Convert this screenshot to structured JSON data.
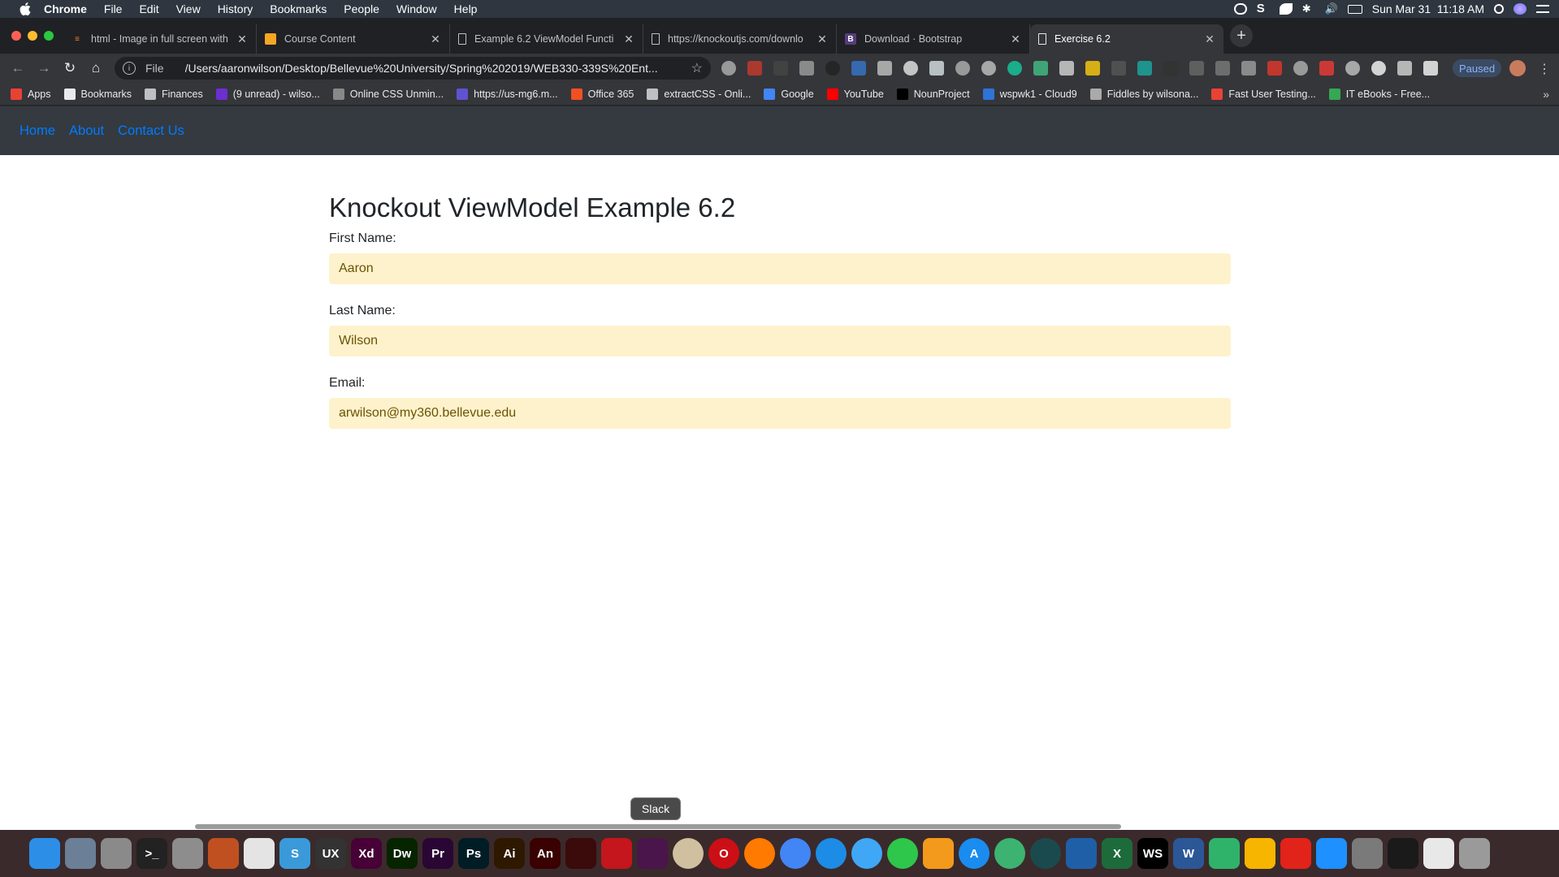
{
  "menubar": {
    "app": "Chrome",
    "items": [
      "File",
      "Edit",
      "View",
      "History",
      "Bookmarks",
      "People",
      "Window",
      "Help"
    ],
    "clock": "Sun Mar 31  11:18 AM"
  },
  "tabs": [
    {
      "title": "html - Image in full screen with",
      "icon": "stackoverflow-icon"
    },
    {
      "title": "Course Content",
      "icon": "course-icon"
    },
    {
      "title": "Example 6.2 ViewModel Functi",
      "icon": "page-icon"
    },
    {
      "title": "https://knockoutjs.com/downlo",
      "icon": "page-icon"
    },
    {
      "title": "Download · Bootstrap",
      "icon": "bootstrap-icon"
    },
    {
      "title": "Exercise 6.2",
      "icon": "page-icon",
      "active": true
    }
  ],
  "omnibox": {
    "scheme": "File",
    "url": "/Users/aaronwilson/Desktop/Bellevue%20University/Spring%202019/WEB330-339S%20Ent..."
  },
  "profile": {
    "status": "Paused"
  },
  "bookmarks": [
    {
      "label": "Apps",
      "color": "#e94235"
    },
    {
      "label": "Bookmarks",
      "color": "#e8eaed"
    },
    {
      "label": "Finances",
      "color": "#bdc1c6"
    },
    {
      "label": "(9 unread) - wilso...",
      "color": "#6b2fd2"
    },
    {
      "label": "Online CSS Unmin...",
      "color": "#888888"
    },
    {
      "label": "https://us-mg6.m...",
      "color": "#5f53d1"
    },
    {
      "label": "Office 365",
      "color": "#f25022"
    },
    {
      "label": "extractCSS - Onli...",
      "color": "#bdc1c6"
    },
    {
      "label": "Google",
      "color": "#4285f4"
    },
    {
      "label": "YouTube",
      "color": "#ff0000"
    },
    {
      "label": "NounProject",
      "color": "#000000"
    },
    {
      "label": "wspwk1 - Cloud9",
      "color": "#2f73d8"
    },
    {
      "label": "Fiddles by wilsona...",
      "color": "#aaaaaa"
    },
    {
      "label": "Fast User Testing...",
      "color": "#e94235"
    },
    {
      "label": "IT eBooks - Free...",
      "color": "#34a853"
    }
  ],
  "page": {
    "nav": [
      "Home",
      "About",
      "Contact Us"
    ],
    "heading": "Knockout ViewModel Example 6.2",
    "fields": [
      {
        "label": "First Name:",
        "value": "Aaron"
      },
      {
        "label": "Last Name:",
        "value": "Wilson"
      },
      {
        "label": "Email:",
        "value": "arwilson@my360.bellevue.edu"
      }
    ]
  },
  "dock": {
    "tooltip": "Slack",
    "apps": [
      {
        "name": "finder",
        "text": "",
        "color": "#2d8ee8"
      },
      {
        "name": "launchpad",
        "text": "",
        "color": "#6b7f96"
      },
      {
        "name": "system-preferences",
        "text": "",
        "color": "#8a8a8a"
      },
      {
        "name": "terminal",
        "text": ">_",
        "color": "#222222"
      },
      {
        "name": "calculator",
        "text": "",
        "color": "#8d8d8d"
      },
      {
        "name": "photo-booth",
        "text": "",
        "color": "#c0501f"
      },
      {
        "name": "reader",
        "text": "",
        "color": "#e4e4e4"
      },
      {
        "name": "sublime",
        "text": "S",
        "color": "#3a9ad9"
      },
      {
        "name": "uxpin",
        "text": "UX",
        "color": "#333333"
      },
      {
        "name": "xd",
        "text": "Xd",
        "color": "#470137"
      },
      {
        "name": "dreamweaver",
        "text": "Dw",
        "color": "#072401"
      },
      {
        "name": "premiere",
        "text": "Pr",
        "color": "#2a0634"
      },
      {
        "name": "photoshop",
        "text": "Ps",
        "color": "#001d26"
      },
      {
        "name": "illustrator",
        "text": "Ai",
        "color": "#2e1900"
      },
      {
        "name": "animate",
        "text": "An",
        "color": "#3a0102"
      },
      {
        "name": "acrobat",
        "text": "",
        "color": "#3b0a0a"
      },
      {
        "name": "acrobat-dc",
        "text": "",
        "color": "#c4161c"
      },
      {
        "name": "slack",
        "text": "",
        "color": "#4a154b"
      },
      {
        "name": "webcam",
        "text": "",
        "color": "#d0c0a0"
      },
      {
        "name": "opera",
        "text": "O",
        "color": "#cc0f16"
      },
      {
        "name": "firefox",
        "text": "",
        "color": "#ff7a00"
      },
      {
        "name": "chrome",
        "text": "",
        "color": "#4285f4"
      },
      {
        "name": "safari",
        "text": "",
        "color": "#1c8ce6"
      },
      {
        "name": "messages",
        "text": "",
        "color": "#3fa7f5"
      },
      {
        "name": "facetime",
        "text": "",
        "color": "#2ec74b"
      },
      {
        "name": "books",
        "text": "",
        "color": "#f39a1c"
      },
      {
        "name": "app-store",
        "text": "A",
        "color": "#1a8cf0"
      },
      {
        "name": "atom",
        "text": "",
        "color": "#3cb371"
      },
      {
        "name": "gitkraken",
        "text": "",
        "color": "#1b4a4e"
      },
      {
        "name": "vscode",
        "text": "",
        "color": "#1f5fa8"
      },
      {
        "name": "excel",
        "text": "X",
        "color": "#1d6b3a"
      },
      {
        "name": "webstorm",
        "text": "WS",
        "color": "#000000"
      },
      {
        "name": "word",
        "text": "W",
        "color": "#2b5797"
      },
      {
        "name": "sourcetree",
        "text": "",
        "color": "#2fb36b"
      },
      {
        "name": "sketch",
        "text": "",
        "color": "#f7b500"
      },
      {
        "name": "roblox",
        "text": "",
        "color": "#e2231a"
      },
      {
        "name": "zeplin",
        "text": "",
        "color": "#1e90ff"
      },
      {
        "name": "utilities",
        "text": "",
        "color": "#7a7a7a"
      },
      {
        "name": "activity-monitor",
        "text": "",
        "color": "#1a1a1a"
      },
      {
        "name": "documents",
        "text": "",
        "color": "#e8e8e8"
      },
      {
        "name": "trash",
        "text": "",
        "color": "#9a9a9a"
      }
    ]
  },
  "colors": {
    "accent_link": "#007bff",
    "navbar_bg": "#343a40",
    "field_bg": "#fef2cc"
  }
}
